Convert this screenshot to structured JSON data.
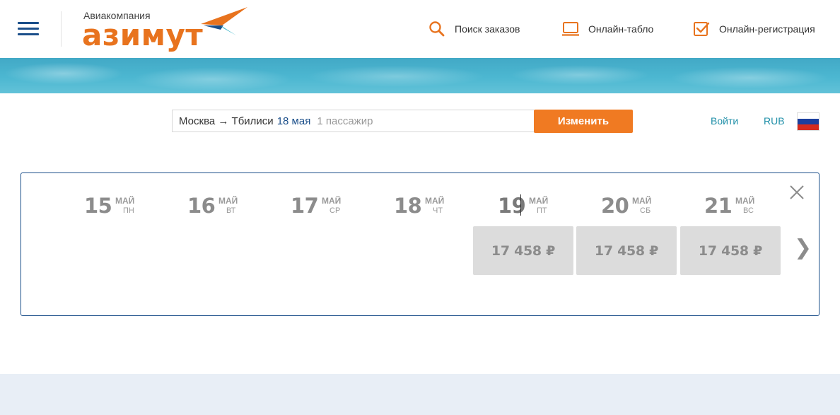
{
  "header": {
    "logo_subtitle": "Авиакомпания",
    "logo_title": "азимут",
    "nav": [
      {
        "label": "Поиск заказов",
        "icon": "search-icon"
      },
      {
        "label": "Онлайн-табло",
        "icon": "monitor-icon"
      },
      {
        "label": "Онлайн-регистрация",
        "icon": "checkbox-icon"
      }
    ]
  },
  "search": {
    "route": "Москва → Тбилиси",
    "date": "18 мая",
    "passengers": "1 пассажир",
    "change_label": "Изменить"
  },
  "account": {
    "login_label": "Войти",
    "currency": "RUB",
    "language_icon": "russia-flag-icon"
  },
  "calendar": {
    "days": [
      {
        "num": "15",
        "month": "МАЙ",
        "weekday": "ПН",
        "price": ""
      },
      {
        "num": "16",
        "month": "МАЙ",
        "weekday": "ВТ",
        "price": ""
      },
      {
        "num": "17",
        "month": "МАЙ",
        "weekday": "СР",
        "price": ""
      },
      {
        "num": "18",
        "month": "МАЙ",
        "weekday": "ЧТ",
        "price": ""
      },
      {
        "num": "19",
        "month": "МАЙ",
        "weekday": "ПТ",
        "price": "17 458 ₽"
      },
      {
        "num": "20",
        "month": "МАЙ",
        "weekday": "СБ",
        "price": "17 458 ₽"
      },
      {
        "num": "21",
        "month": "МАЙ",
        "weekday": "ВС",
        "price": "17 458 ₽"
      }
    ],
    "next_icon": "chevron-right-icon",
    "close_icon": "close-icon"
  },
  "colors": {
    "brand_orange": "#f07a22",
    "brand_blue": "#1b4f8a",
    "link_teal": "#1f8fa8"
  }
}
